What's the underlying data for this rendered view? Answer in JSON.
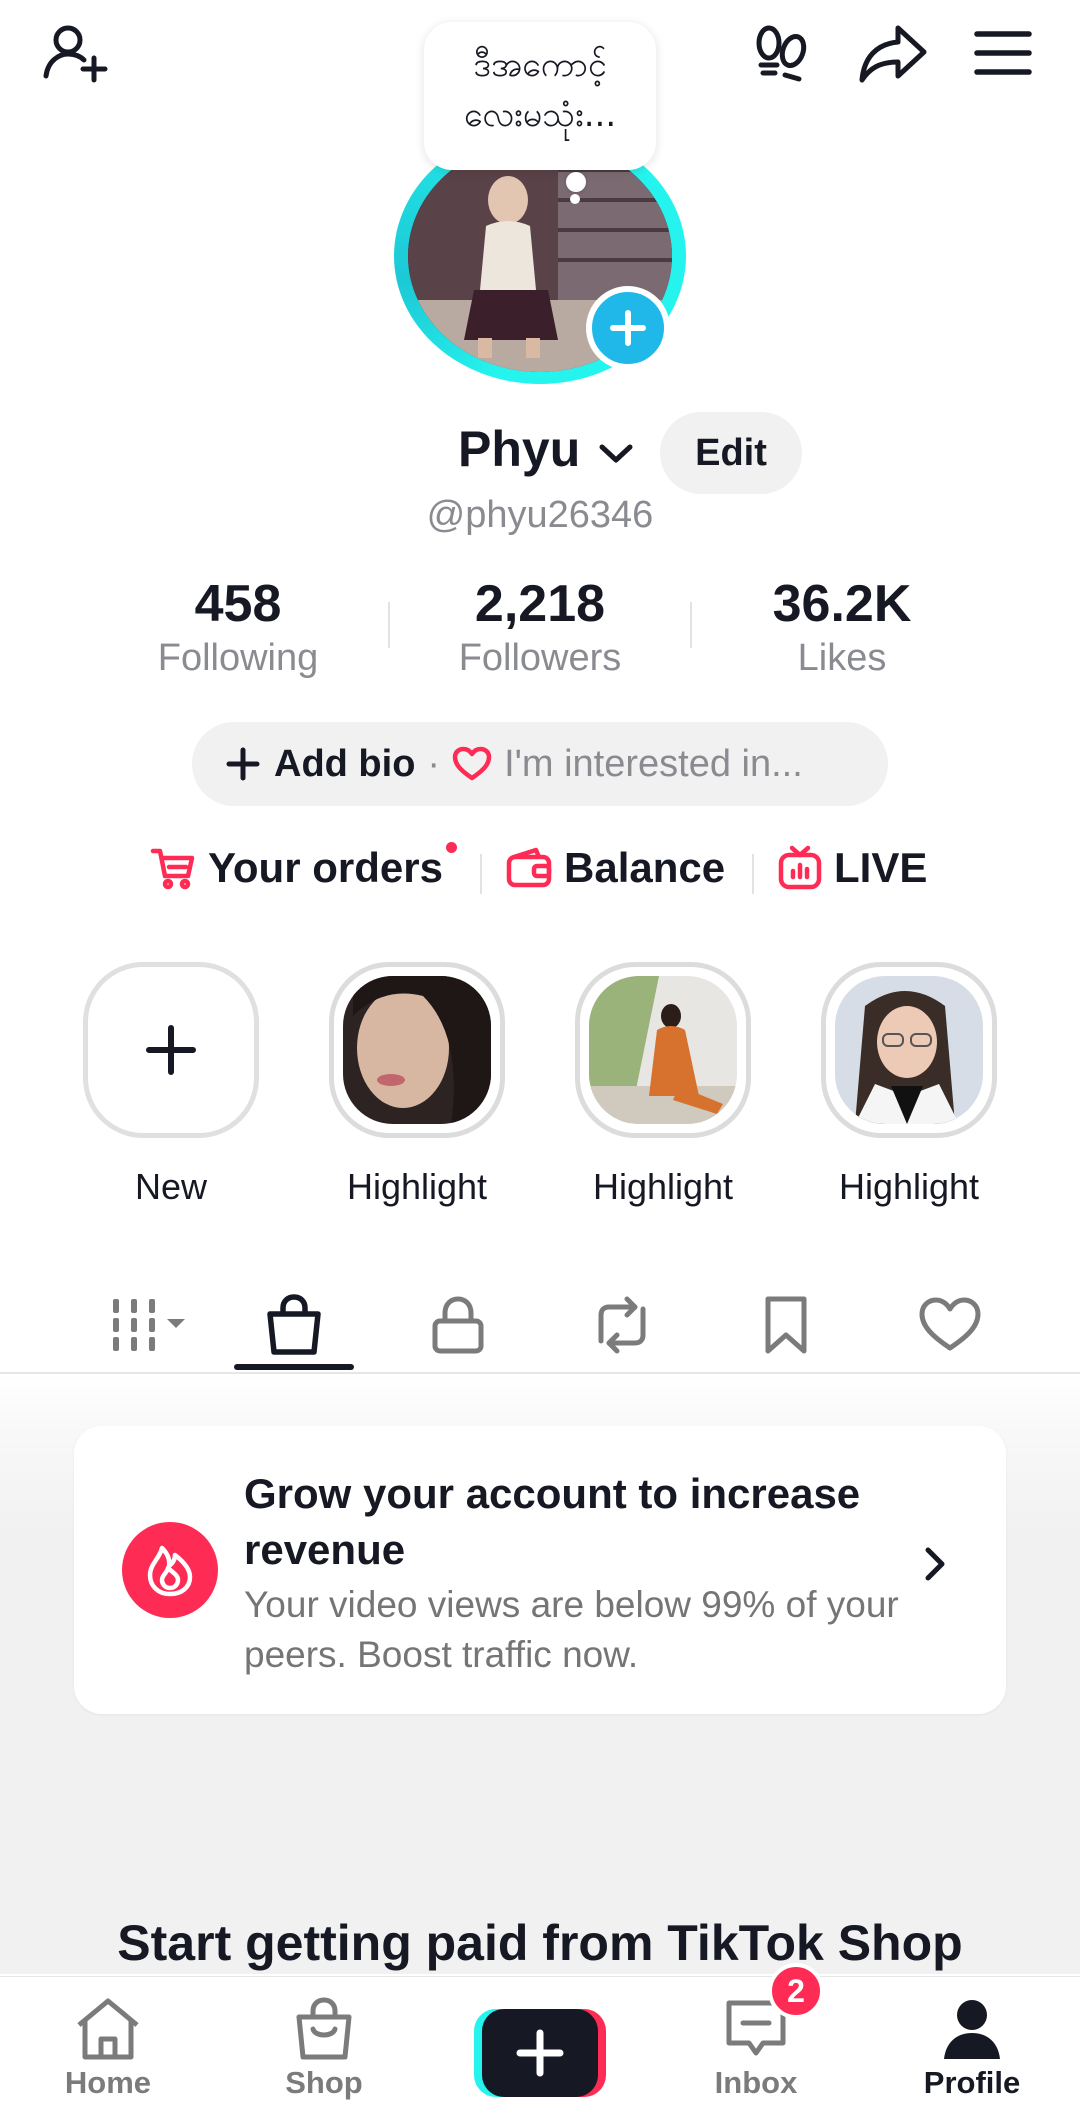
{
  "note": {
    "line1": "ဒီအကောင့်",
    "line2": "လေးမသုံး..."
  },
  "profile": {
    "name": "Phyu",
    "edit_label": "Edit",
    "handle": "@phyu26346"
  },
  "stats": [
    {
      "value": "458",
      "label": "Following"
    },
    {
      "value": "2,218",
      "label": "Followers"
    },
    {
      "value": "36.2K",
      "label": "Likes"
    }
  ],
  "bio": {
    "add_label": "Add bio",
    "separator": "·",
    "interest_label": "I'm interested in..."
  },
  "quick_links": [
    {
      "label": "Your orders",
      "icon": "cart-icon"
    },
    {
      "label": "Balance",
      "icon": "wallet-icon"
    },
    {
      "label": "LIVE",
      "icon": "live-tv-icon"
    }
  ],
  "highlights": [
    {
      "label": "New"
    },
    {
      "label": "Highlight"
    },
    {
      "label": "Highlight"
    },
    {
      "label": "Highlight"
    }
  ],
  "tabs": [
    {
      "icon": "grid-icon"
    },
    {
      "icon": "shopping-bag-icon",
      "active": true
    },
    {
      "icon": "lock-icon"
    },
    {
      "icon": "repost-icon"
    },
    {
      "icon": "bookmark-icon"
    },
    {
      "icon": "heart-icon"
    }
  ],
  "promo": {
    "title": "Grow your account to increase revenue",
    "subtitle": "Your video views are below 99% of your peers. Boost traffic now."
  },
  "shop_heading": "Start getting paid from TikTok Shop",
  "nav": {
    "home": "Home",
    "shop": "Shop",
    "inbox": "Inbox",
    "inbox_badge": "2",
    "profile": "Profile"
  },
  "colors": {
    "accent": "#fe2c55",
    "ring": "#25f4ee",
    "plus_badge": "#20b8e8"
  }
}
